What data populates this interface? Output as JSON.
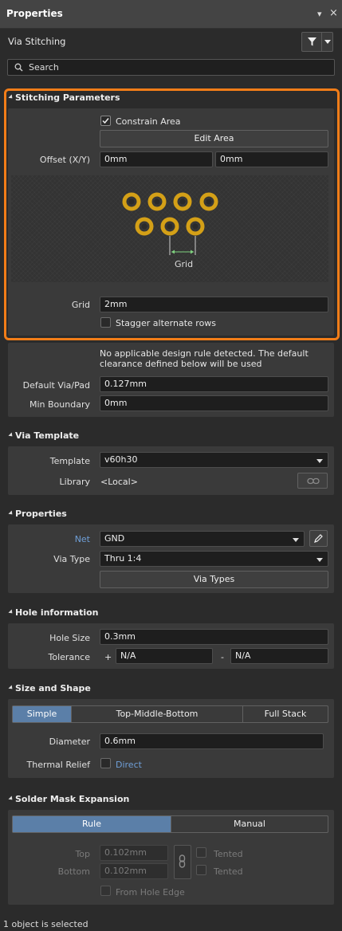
{
  "titlebar": {
    "title": "Properties",
    "pin_glyph": "▾",
    "close_glyph": "×"
  },
  "header": {
    "label": "Via Stitching"
  },
  "search": {
    "placeholder": "Search"
  },
  "stitching": {
    "title": "Stitching Parameters",
    "constrain_area_label": "Constrain Area",
    "constrain_area_checked": true,
    "edit_area_label": "Edit Area",
    "offset_label": "Offset (X/Y)",
    "offset_x": "0mm",
    "offset_y": "0mm",
    "preview_grid_label": "Grid",
    "grid_label": "Grid",
    "grid_value": "2mm",
    "stagger_label": "Stagger alternate rows",
    "stagger_checked": false
  },
  "rule_info": {
    "message_line1": "No applicable design rule detected. The default",
    "message_line2": "clearance defined below will be used",
    "default_via_pad_label": "Default Via/Pad",
    "default_via_pad_value": "0.127mm",
    "min_boundary_label": "Min Boundary",
    "min_boundary_value": "0mm"
  },
  "via_template": {
    "title": "Via Template",
    "template_label": "Template",
    "template_value": "v60h30",
    "library_label": "Library",
    "library_value": "<Local>"
  },
  "properties": {
    "title": "Properties",
    "net_label": "Net",
    "net_value": "GND",
    "via_type_label": "Via Type",
    "via_type_value": "Thru 1:4",
    "via_types_button": "Via Types"
  },
  "hole": {
    "title": "Hole information",
    "hole_size_label": "Hole Size",
    "hole_size_value": "0.3mm",
    "tolerance_label": "Tolerance",
    "plus_sign": "+",
    "tol_plus_value": "N/A",
    "minus_sign": "-",
    "tol_minus_value": "N/A"
  },
  "size_shape": {
    "title": "Size and Shape",
    "tabs": [
      "Simple",
      "Top-Middle-Bottom",
      "Full Stack"
    ],
    "active_tab": "Simple",
    "diameter_label": "Diameter",
    "diameter_value": "0.6mm",
    "thermal_relief_label": "Thermal Relief",
    "thermal_relief_value": "Direct"
  },
  "solder_mask": {
    "title": "Solder Mask Expansion",
    "tabs": [
      "Rule",
      "Manual"
    ],
    "active_tab": "Rule",
    "top_label": "Top",
    "top_value": "0.102mm",
    "bottom_label": "Bottom",
    "bottom_value": "0.102mm",
    "tented_top_label": "Tented",
    "tented_bottom_label": "Tented",
    "from_hole_edge_label": "From Hole Edge"
  },
  "status": {
    "text": "1 object is selected"
  },
  "colors": {
    "accent_orange": "#f27d18",
    "active_tab": "#5b7fa8",
    "link": "#6f9fd8",
    "via_pad": "#d4a017"
  }
}
